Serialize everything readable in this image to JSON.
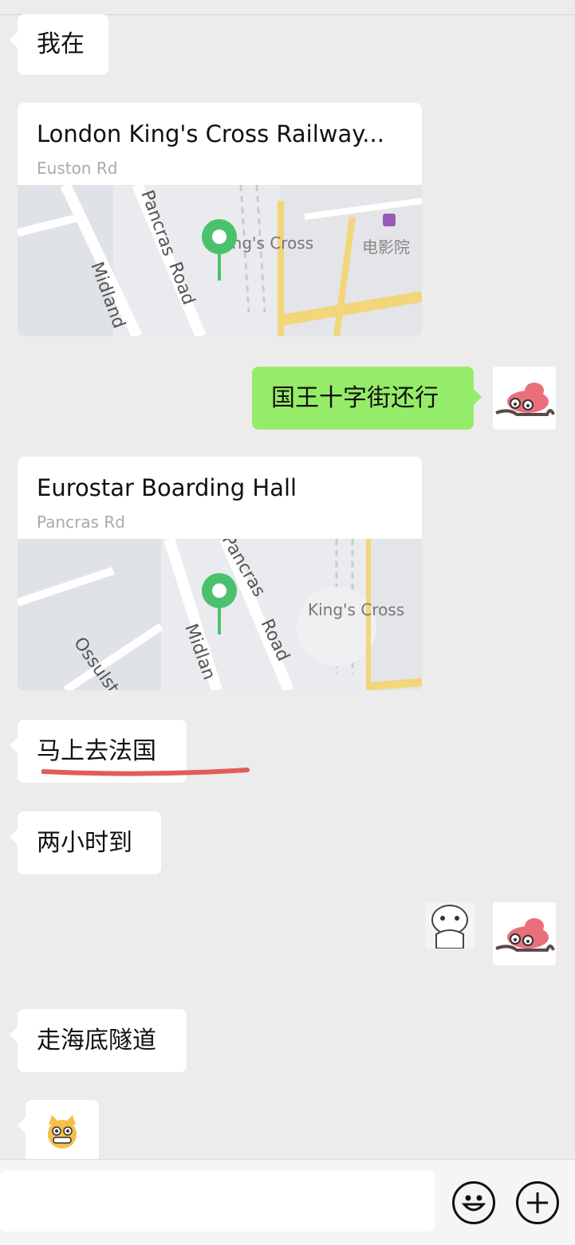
{
  "messages": {
    "m1": {
      "text": "我在"
    },
    "loc1": {
      "title": "London King's Cross Railway...",
      "subtitle": "Euston Rd",
      "map_labels": {
        "street1": "Midland",
        "street2": "Pancras",
        "street3": "Road",
        "station": "King's Cross",
        "poi": "电影院"
      }
    },
    "m2": {
      "text": "国王十字街还行"
    },
    "loc2": {
      "title": "Eurostar Boarding Hall",
      "subtitle": "Pancras Rd",
      "map_labels": {
        "street1": "Ossulst",
        "street2": "Midlan",
        "street3": "Pancras",
        "street4": "Road",
        "station": "King's Cross"
      }
    },
    "m3": {
      "text": "马上去法国"
    },
    "m4": {
      "text": "两小时到"
    },
    "m5": {
      "text": "走海底隧道"
    }
  },
  "icons": {
    "emoji": "emoji-icon",
    "plus": "plus-icon"
  },
  "colors": {
    "background": "#ececec",
    "outgoing": "#95ec69",
    "map_pin": "#4cc16d",
    "underline": "#e55b5b"
  }
}
